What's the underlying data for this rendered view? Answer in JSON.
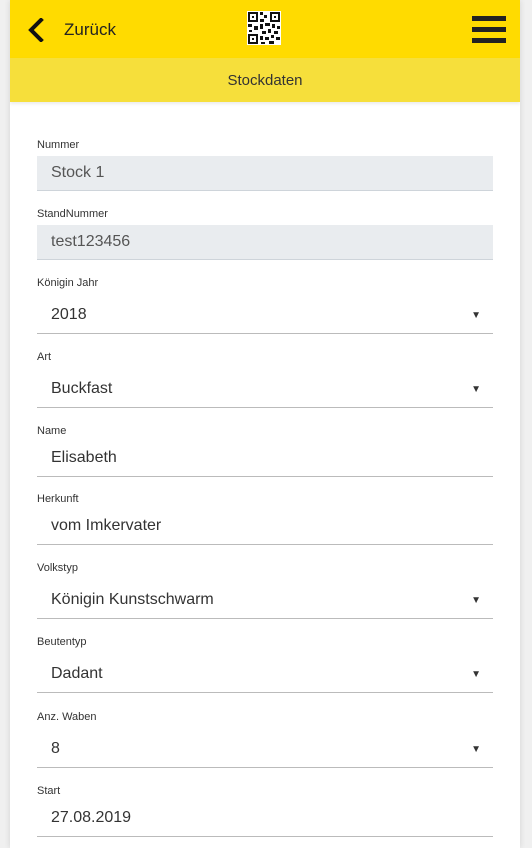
{
  "topbar": {
    "back_label": "Zurück",
    "back_icon": "chevron-left-icon",
    "qr_icon": "qr-code-icon",
    "menu_icon": "hamburger-menu-icon",
    "background": "#ffdb00"
  },
  "subbar": {
    "title": "Stockdaten",
    "background": "#f6df3b"
  },
  "form": {
    "nummer": {
      "label": "Nummer",
      "value": "Stock 1"
    },
    "standnummer": {
      "label": "StandNummer",
      "value": "test123456"
    },
    "koenigin_jahr": {
      "label": "Königin Jahr",
      "value": "2018"
    },
    "art": {
      "label": "Art",
      "value": "Buckfast"
    },
    "name": {
      "label": "Name",
      "value": "Elisabeth"
    },
    "herkunft": {
      "label": "Herkunft",
      "value": "vom Imkervater"
    },
    "volkstyp": {
      "label": "Volkstyp",
      "value": "Königin Kunstschwarm"
    },
    "beutentyp": {
      "label": "Beutentyp",
      "value": "Dadant"
    },
    "anz_waben": {
      "label": "Anz. Waben",
      "value": "8"
    },
    "start": {
      "label": "Start",
      "value": "27.08.2019"
    }
  }
}
